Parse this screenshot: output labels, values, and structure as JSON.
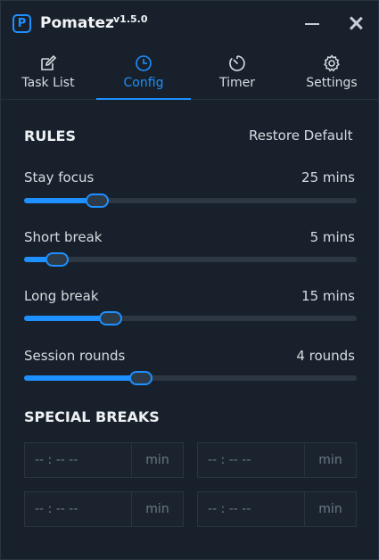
{
  "window": {
    "title": "Pomatez",
    "version": "v1.5.0",
    "logo_letter": "P"
  },
  "tabs": [
    {
      "label": "Task List",
      "icon": "edit-icon",
      "active": false
    },
    {
      "label": "Config",
      "icon": "clock-icon",
      "active": true
    },
    {
      "label": "Timer",
      "icon": "timer-icon",
      "active": false
    },
    {
      "label": "Settings",
      "icon": "gear-icon",
      "active": false
    }
  ],
  "rules": {
    "title": "RULES",
    "restore_label": "Restore Default",
    "items": [
      {
        "label": "Stay focus",
        "value": "25 mins",
        "level": 0.22
      },
      {
        "label": "Short break",
        "value": "5 mins",
        "level": 0.1
      },
      {
        "label": "Long break",
        "value": "15 mins",
        "level": 0.26
      },
      {
        "label": "Session rounds",
        "value": "4 rounds",
        "level": 0.35
      }
    ]
  },
  "special_breaks": {
    "title": "SPECIAL BREAKS",
    "fields": [
      {
        "time_placeholder": "-- : --   --",
        "unit": "min"
      },
      {
        "time_placeholder": "-- : --   --",
        "unit": "min"
      },
      {
        "time_placeholder": "-- : --   --",
        "unit": "min"
      },
      {
        "time_placeholder": "-- : --   --",
        "unit": "min"
      }
    ]
  },
  "colors": {
    "accent": "#1e90ff",
    "background": "#18212b",
    "track": "#2d3743"
  }
}
